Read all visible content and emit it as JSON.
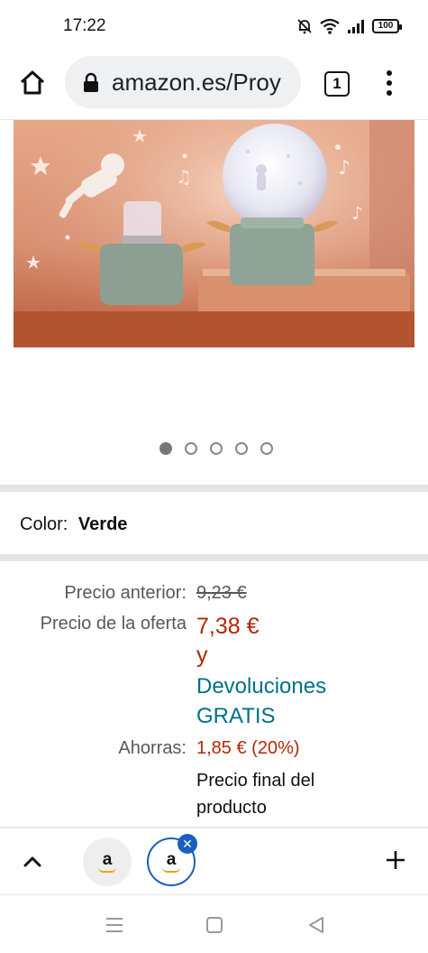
{
  "status_bar": {
    "time": "17:22",
    "battery": "100",
    "icons": [
      "mute-bell-icon",
      "wifi-icon",
      "signal-icon",
      "battery-icon"
    ]
  },
  "browser": {
    "url": "amazon.es/Proy",
    "tab_count": "1",
    "icons": [
      "home-icon",
      "lock-icon",
      "tabs-icon",
      "overflow-menu-icon"
    ]
  },
  "product": {
    "carousel": {
      "total": 5,
      "active_index": 0
    },
    "color_label": "Color:",
    "color_value": "Verde"
  },
  "pricing": {
    "previous_label": "Precio anterior:",
    "previous_value": "9,23 €",
    "deal_label": "Precio de la oferta",
    "deal_value": "7,38 €",
    "deal_y": "y",
    "free_returns_line1": "Devoluciones",
    "free_returns_line2": "GRATIS",
    "savings_label": "Ahorras:",
    "savings_value": "1,85 € (20%)",
    "final_note": "Precio final del producto"
  },
  "tab_strip": {
    "tabs": [
      {
        "logo_letter": "a",
        "active": false
      },
      {
        "logo_letter": "a",
        "active": true
      }
    ],
    "close_glyph": "✕",
    "icons": [
      "chevron-up-icon",
      "amazon-logo-icon",
      "close-tab-icon",
      "plus-icon"
    ]
  },
  "colors": {
    "deal_red": "#b12704",
    "link_teal": "#007185",
    "active_tab_blue": "#1a5fc2"
  }
}
